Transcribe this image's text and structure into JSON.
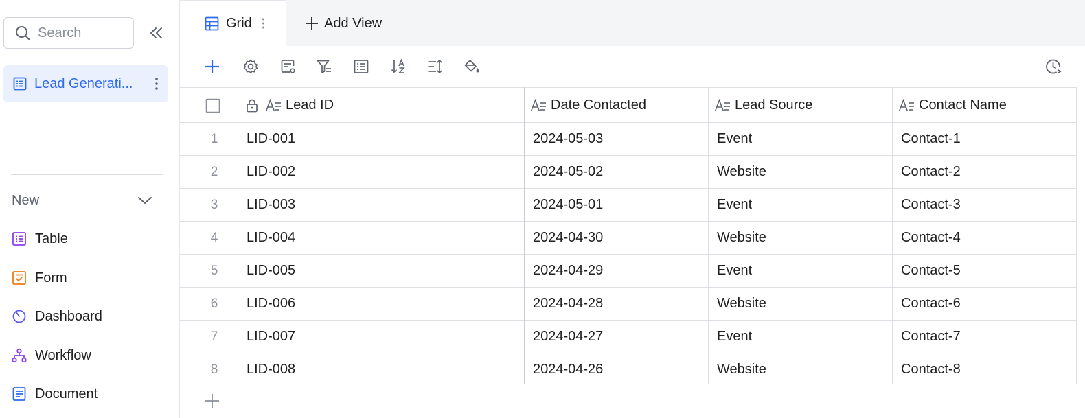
{
  "sidebar": {
    "search_placeholder": "Search",
    "active_item": "Lead Generati...",
    "new_label": "New",
    "create_items": [
      {
        "label": "Table",
        "icon": "table-icon",
        "color": "#8b3ff0"
      },
      {
        "label": "Form",
        "icon": "form-icon",
        "color": "#f07c1a"
      },
      {
        "label": "Dashboard",
        "icon": "dashboard-icon",
        "color": "#5b5bf0"
      },
      {
        "label": "Workflow",
        "icon": "workflow-icon",
        "color": "#8b3ff0"
      },
      {
        "label": "Document",
        "icon": "document-icon",
        "color": "#2f6bef"
      }
    ]
  },
  "tabs": {
    "grid_label": "Grid",
    "add_view_label": "Add View"
  },
  "toolbar": {
    "buttons": [
      "add-record-icon",
      "settings-icon",
      "field-config-icon",
      "filter-icon",
      "group-icon",
      "sort-icon",
      "row-height-icon",
      "color-fill-icon",
      "history-icon"
    ]
  },
  "table": {
    "columns": [
      "Lead ID",
      "Date Contacted",
      "Lead Source",
      "Contact Name"
    ],
    "rows": [
      {
        "n": "1",
        "lead_id": "LID-001",
        "date": "2024-05-03",
        "source": "Event",
        "contact": "Contact-1"
      },
      {
        "n": "2",
        "lead_id": "LID-002",
        "date": "2024-05-02",
        "source": "Website",
        "contact": "Contact-2"
      },
      {
        "n": "3",
        "lead_id": "LID-003",
        "date": "2024-05-01",
        "source": "Event",
        "contact": "Contact-3"
      },
      {
        "n": "4",
        "lead_id": "LID-004",
        "date": "2024-04-30",
        "source": "Website",
        "contact": "Contact-4"
      },
      {
        "n": "5",
        "lead_id": "LID-005",
        "date": "2024-04-29",
        "source": "Event",
        "contact": "Contact-5"
      },
      {
        "n": "6",
        "lead_id": "LID-006",
        "date": "2024-04-28",
        "source": "Website",
        "contact": "Contact-6"
      },
      {
        "n": "7",
        "lead_id": "LID-007",
        "date": "2024-04-27",
        "source": "Event",
        "contact": "Contact-7"
      },
      {
        "n": "8",
        "lead_id": "LID-008",
        "date": "2024-04-26",
        "source": "Website",
        "contact": "Contact-8"
      }
    ]
  },
  "colors": {
    "accent": "#2f6bef",
    "active_bg": "#eaf0fe",
    "border": "#dcdfe4",
    "muted_text": "#8a8f99"
  }
}
